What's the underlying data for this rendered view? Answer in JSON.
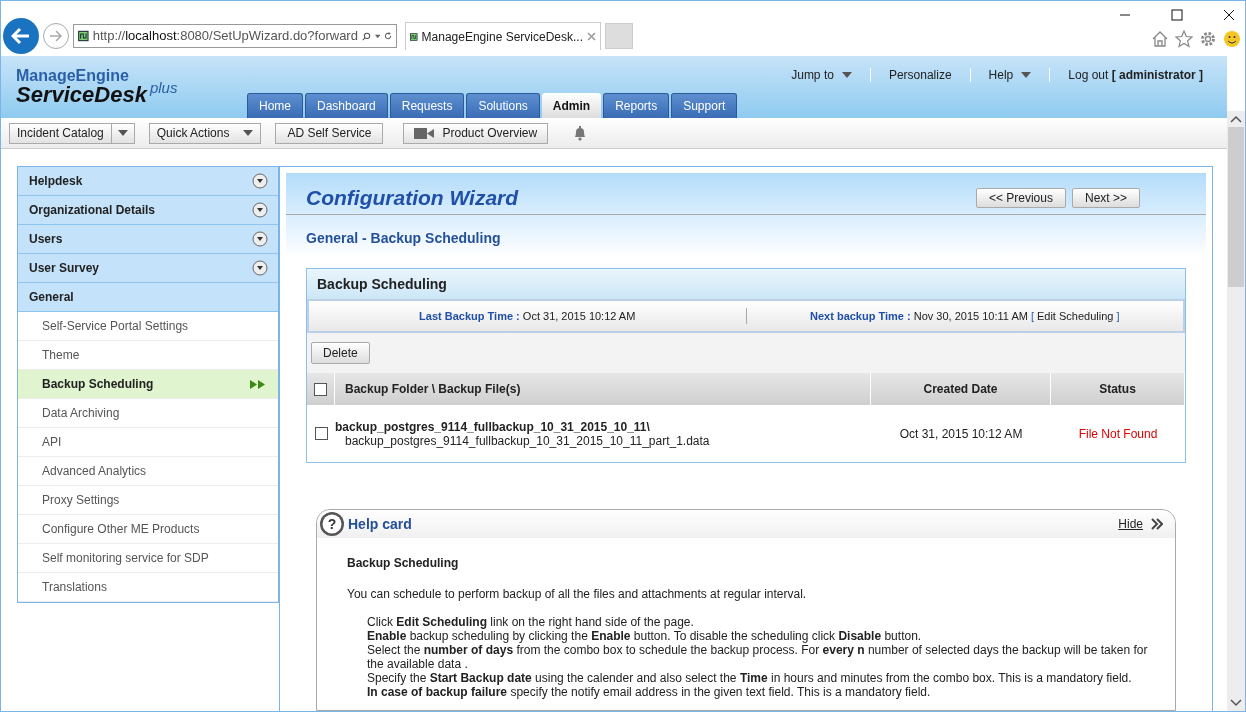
{
  "browser": {
    "address_prefix": "http://",
    "address_host": "localhost",
    "address_rest": ":8080/SetUpWizard.do?forward",
    "tab_title": "ManageEngine ServiceDesk..."
  },
  "header": {
    "brand": "ManageEngine",
    "product": "ServiceDesk",
    "edition": "plus",
    "top_links": [
      {
        "label": "Jump to",
        "dropdown": true
      },
      {
        "label": "Personalize",
        "dropdown": false
      },
      {
        "label": "Help",
        "dropdown": true
      },
      {
        "label": "Log out **[ administrator ]**",
        "dropdown": false
      }
    ]
  },
  "tabs": [
    {
      "label": "Home",
      "selected": false
    },
    {
      "label": "Dashboard",
      "selected": false
    },
    {
      "label": "Requests",
      "selected": false
    },
    {
      "label": "Solutions",
      "selected": false
    },
    {
      "label": "Admin",
      "selected": true
    },
    {
      "label": "Reports",
      "selected": false
    },
    {
      "label": "Support",
      "selected": false
    }
  ],
  "toolbar": [
    {
      "label": "Incident Catalog",
      "kind": "split"
    },
    {
      "label": "Quick Actions",
      "kind": "dropdown"
    },
    {
      "label": "AD Self Service",
      "kind": "plain"
    },
    {
      "label": "Product Overview",
      "kind": "video"
    }
  ],
  "sidebar": [
    {
      "label": "Helpdesk",
      "expanded": false
    },
    {
      "label": "Organizational Details",
      "expanded": false
    },
    {
      "label": "Users",
      "expanded": false
    },
    {
      "label": "User Survey",
      "expanded": false
    },
    {
      "label": "General",
      "expanded": true,
      "children": [
        {
          "label": "Self-Service Portal Settings",
          "selected": false
        },
        {
          "label": "Theme",
          "selected": false
        },
        {
          "label": "Backup Scheduling",
          "selected": true
        },
        {
          "label": "Data Archiving",
          "selected": false
        },
        {
          "label": "API",
          "selected": false
        },
        {
          "label": "Advanced Analytics",
          "selected": false
        },
        {
          "label": "Proxy Settings",
          "selected": false
        },
        {
          "label": "Configure Other ME Products",
          "selected": false
        },
        {
          "label": "Self monitoring service for SDP",
          "selected": false
        },
        {
          "label": "Translations",
          "selected": false
        }
      ]
    }
  ],
  "wizard": {
    "title": "Configuration Wizard",
    "previous": "<< Previous",
    "next": "Next >>",
    "subtitle": "General - Backup Scheduling"
  },
  "panel": {
    "title": "Backup Scheduling",
    "last_label": "Last Backup Time :",
    "last_value": "Oct 31, 2015 10:12 AM",
    "next_label": "Next backup Time :",
    "next_value": "Nov 30, 2015 10:11 AM",
    "edit_open": "[",
    "edit_link": "Edit Scheduling",
    "edit_close": "]",
    "delete": "Delete",
    "all_checked": false,
    "columns": [
      "Backup Folder \\ Backup File(s)",
      "Created Date",
      "Status"
    ],
    "rows": [
      {
        "folder": "backup_postgres_9114_fullbackup_10_31_2015_10_11\\",
        "file": "backup_postgres_9114_fullbackup_10_31_2015_10_11_part_1.data",
        "created": "Oct 31, 2015 10:12 AM",
        "status": "File Not Found",
        "checked": false
      }
    ]
  },
  "help": {
    "icon": "?",
    "title": "Help card",
    "hide": "Hide",
    "heading": "Backup Scheduling",
    "intro": "You can schedule to perform backup of all the files and attachments at regular interval.",
    "steps": [
      "Click **Edit Scheduling** link on the right hand side of the page.",
      "**Enable** backup scheduling by clicking the **Enable** button. To disable the scheduling click **Disable** button.",
      "Select the **number of days** from the combo box to schedule the backup process. For **every n** number of selected days the backup will be taken for the available data .",
      "Specify the **Start Backup date** using the calender and also select the **Time** in hours and minutes from the combo box. This is a mandatory field.",
      "**In case of backup failure** specify the notify email address in the given text field. This is a mandatory field."
    ]
  }
}
